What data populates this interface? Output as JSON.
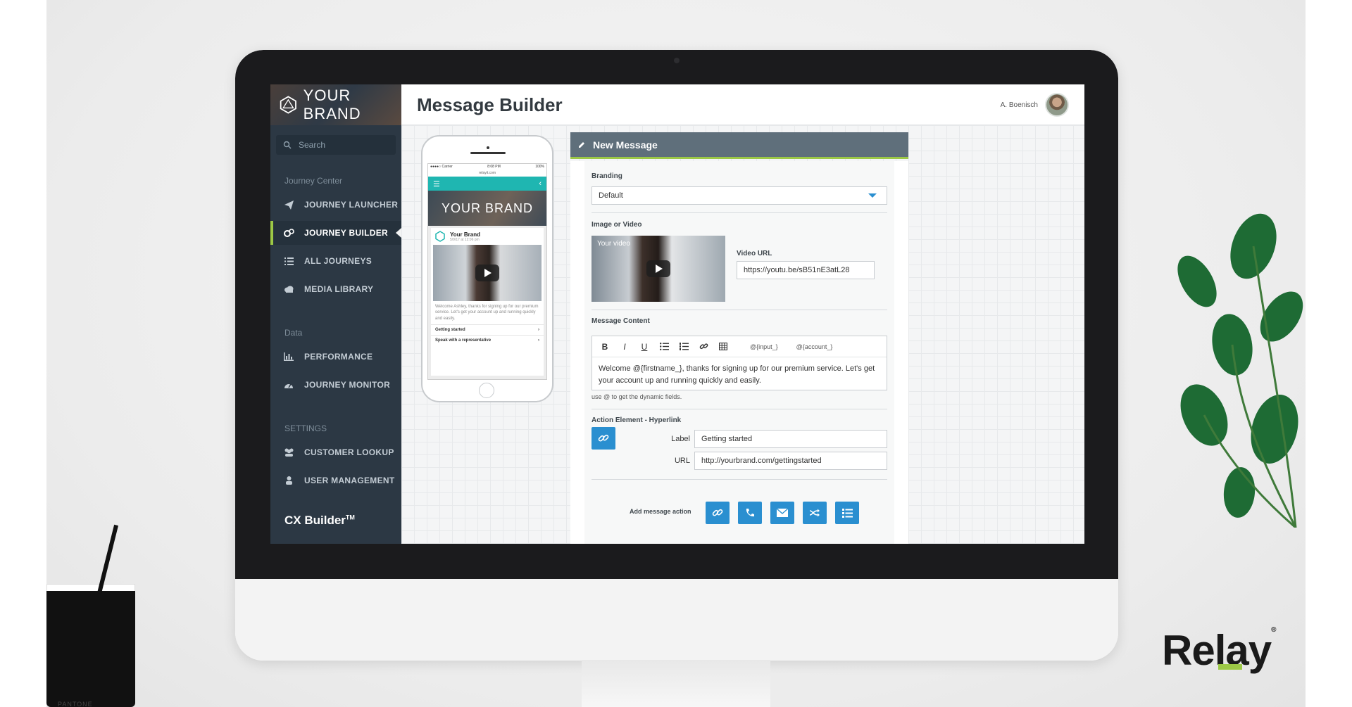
{
  "app": {
    "brand_name": "YOUR BRAND",
    "page_title": "Message Builder",
    "user_name": "A. Boenisch"
  },
  "sidebar": {
    "search_placeholder": "Search",
    "sections": [
      {
        "title": "Journey Center",
        "items": [
          {
            "label": "JOURNEY LAUNCHER",
            "icon": "paper-plane-icon"
          },
          {
            "label": "JOURNEY BUILDER",
            "icon": "cogs-icon",
            "active": true
          },
          {
            "label": "ALL JOURNEYS",
            "icon": "list-icon"
          },
          {
            "label": "MEDIA LIBRARY",
            "icon": "cloud-icon"
          }
        ]
      },
      {
        "title": "Data",
        "items": [
          {
            "label": "PERFORMANCE",
            "icon": "bar-chart-icon"
          },
          {
            "label": "JOURNEY MONITOR",
            "icon": "dashboard-icon"
          }
        ]
      },
      {
        "title": "SETTINGS",
        "items": [
          {
            "label": "CUSTOMER LOOKUP",
            "icon": "users-icon"
          },
          {
            "label": "USER MANAGEMENT",
            "icon": "user-icon"
          }
        ]
      }
    ],
    "product_name": "CX Builder",
    "product_mark": "TM"
  },
  "phone_preview": {
    "status_left": "●●●●○ Carrier",
    "status_center": "8:08 PM",
    "status_right": "100%",
    "url": "relayit.com",
    "hero_text": "YOUR BRAND",
    "card_brand": "Your Brand",
    "card_date": "5/9/17 at 12:06 pm",
    "card_text": "Welcome Ashley, thanks for signing up for our premium service. Let's get your account up and running quickly and easily.",
    "links": [
      "Getting started",
      "Speak with a representative"
    ]
  },
  "panel": {
    "title": "New Message",
    "branding_label": "Branding",
    "branding_value": "Default",
    "media_label": "Image or Video",
    "video_caption": "Your video",
    "video_url_label": "Video URL",
    "video_url_value": "https://youtu.be/sB51nE3atL28",
    "content_label": "Message Content",
    "toolbar": {
      "bold": "B",
      "italic": "I",
      "underline": "U",
      "field_input": "@{input_}",
      "field_account": "@{account_}"
    },
    "content_text": "Welcome @{firstname_}, thanks for signing up for our premium service. Let's get your account up and running quickly and easily.",
    "hint": "use @ to get the dynamic fields.",
    "action_label": "Action Element - Hyperlink",
    "label_label": "Label",
    "label_value": "Getting started",
    "url_label": "URL",
    "url_value": "http://yourbrand.com/gettingstarted",
    "add_action_label": "Add message action",
    "action_buttons": [
      "link-icon",
      "phone-icon",
      "envelope-icon",
      "share-icon",
      "list-icon"
    ]
  },
  "decor": {
    "relay_logo": "Relay",
    "relay_reg": "®",
    "cup_label": "PANTONE"
  },
  "colors": {
    "sidebar_bg": "#2c3844",
    "accent_green": "#9cc846",
    "accent_blue": "#2a8fd0",
    "teal": "#1fb6b1"
  }
}
